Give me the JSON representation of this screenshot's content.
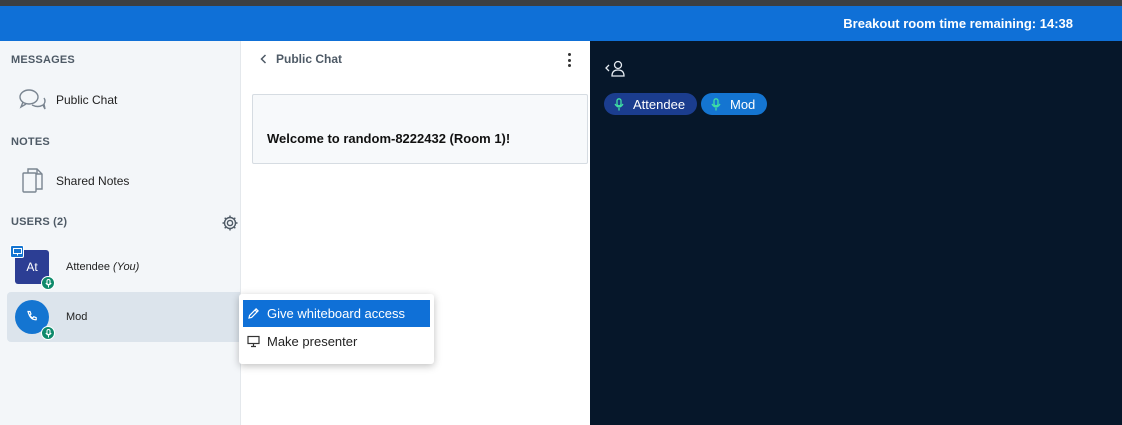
{
  "banner": {
    "text": "Breakout room time remaining: 14:38"
  },
  "sidebar": {
    "messages_title": "MESSAGES",
    "public_chat_label": "Public Chat",
    "notes_title": "NOTES",
    "shared_notes_label": "Shared Notes",
    "users_title": "USERS (2)",
    "users": [
      {
        "initials": "At",
        "name": "Attendee",
        "suffix": "(You)"
      },
      {
        "name": "Mod"
      }
    ]
  },
  "chat": {
    "title": "Public Chat",
    "welcome": "Welcome to random-8222432 (Room 1)!"
  },
  "menu": {
    "items": [
      {
        "label": "Give whiteboard access"
      },
      {
        "label": "Make presenter"
      }
    ]
  },
  "talkers": [
    {
      "name": "Attendee",
      "color": "#1b3d8e"
    },
    {
      "name": "Mod",
      "color": "#1475d1"
    }
  ],
  "colors": {
    "banner": "#0f70d7",
    "sidebar_bg": "#f3f6f9",
    "media_bg": "#06172a",
    "mic_badge": "#0e8a6b"
  }
}
